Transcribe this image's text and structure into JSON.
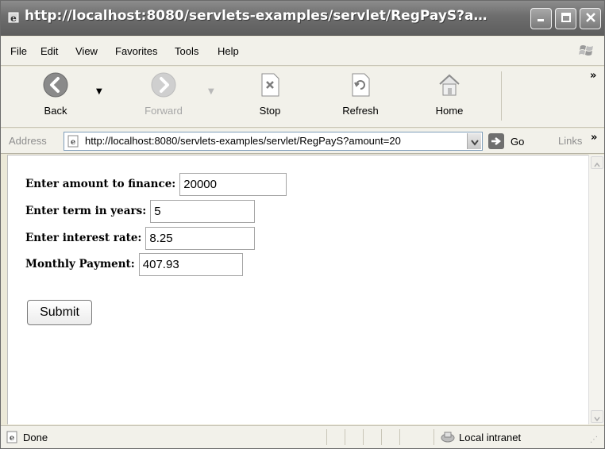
{
  "window": {
    "title": "http://localhost:8080/servlets-examples/servlet/RegPayS?amount=20…"
  },
  "menu": {
    "items": [
      "File",
      "Edit",
      "View",
      "Favorites",
      "Tools",
      "Help"
    ]
  },
  "toolbar": {
    "back_label": "Back",
    "forward_label": "Forward",
    "stop_label": "Stop",
    "refresh_label": "Refresh",
    "home_label": "Home"
  },
  "address": {
    "label": "Address",
    "url": "http://localhost:8080/servlets-examples/servlet/RegPayS?amount=20",
    "go_label": "Go",
    "links_label": "Links"
  },
  "form": {
    "amount_label": "Enter amount to finance:",
    "amount_value": "20000",
    "term_label": "Enter term in years:",
    "term_value": "5",
    "rate_label": "Enter interest rate:",
    "rate_value": "8.25",
    "payment_label": "Monthly Payment:",
    "payment_value": "407.93",
    "submit_label": "Submit"
  },
  "status": {
    "text": "Done",
    "zone": "Local intranet"
  },
  "icons": {
    "title": "ie-icon",
    "back": "back-arrow-icon",
    "forward": "forward-arrow-icon",
    "stop": "stop-icon",
    "refresh": "refresh-icon",
    "home": "home-icon",
    "go": "go-arrow-icon",
    "zone": "local-intranet-icon"
  },
  "colors": {
    "title_bar": "#6d6d6d",
    "chrome": "#f2f1ea"
  }
}
